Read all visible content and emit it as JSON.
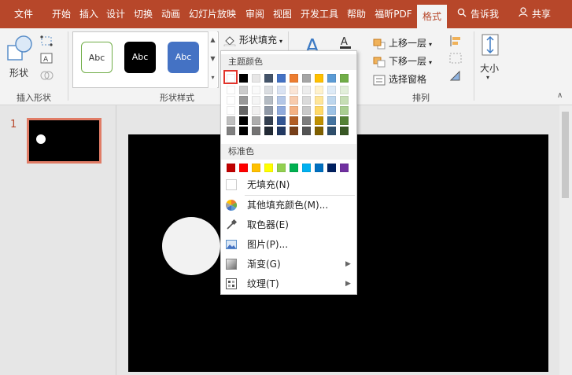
{
  "tabs": [
    {
      "label": "文件"
    },
    {
      "label": "开始"
    },
    {
      "label": "插入"
    },
    {
      "label": "设计"
    },
    {
      "label": "切换"
    },
    {
      "label": "动画"
    },
    {
      "label": "幻灯片放映"
    },
    {
      "label": "审阅"
    },
    {
      "label": "视图"
    },
    {
      "label": "开发工具"
    },
    {
      "label": "帮助"
    },
    {
      "label": "福昕PDF"
    },
    {
      "label": "格式"
    }
  ],
  "tell_me": "告诉我",
  "share": "共享",
  "ribbon": {
    "insert_shapes": {
      "shapes_label": "形状",
      "group_label": "插入形状"
    },
    "shape_styles": {
      "samples": [
        "Abc",
        "Abc",
        "Abc"
      ],
      "fill_button": "形状填充",
      "group_label": "形状样式"
    },
    "arrange": {
      "bring_forward": "上移一层",
      "send_backward": "下移一层",
      "selection_pane": "选择窗格",
      "size": "大小",
      "group_label": "排列"
    }
  },
  "slides_panel": {
    "slide_number": "1"
  },
  "fill_menu": {
    "theme_colors_header": "主题颜色",
    "standard_colors_header": "标准色",
    "theme_colors": [
      "#ffffff",
      "#000000",
      "#e7e6e6",
      "#44546a",
      "#4472c4",
      "#ed7d31",
      "#a5a5a5",
      "#ffc000",
      "#5b9bd5",
      "#70ad47"
    ],
    "standard_colors": [
      "#c00000",
      "#ff0000",
      "#ffc000",
      "#ffff00",
      "#92d050",
      "#00b050",
      "#00b0f0",
      "#0070c0",
      "#002060",
      "#7030a0"
    ],
    "items": [
      {
        "label": "无填充(N)",
        "icon": "no-fill-icon"
      },
      {
        "label": "其他填充颜色(M)...",
        "icon": "color-wheel-icon"
      },
      {
        "label": "取色器(E)",
        "icon": "eyedropper-icon"
      },
      {
        "label": "图片(P)...",
        "icon": "picture-icon"
      },
      {
        "label": "渐变(G)",
        "icon": "gradient-icon"
      },
      {
        "label": "纹理(T)",
        "icon": "texture-icon"
      }
    ]
  },
  "colors": {
    "accent": "#b7472a",
    "selection": "#e2342b",
    "slide_bg": "#000000",
    "circle_fill": "#f2f2f2"
  }
}
